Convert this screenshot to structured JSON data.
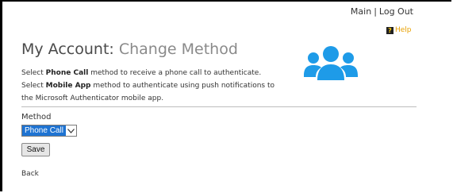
{
  "nav": {
    "main": "Main",
    "separator": "|",
    "logout": "Log Out"
  },
  "help": {
    "icon_glyph": "?",
    "label": "Help",
    "color": "#e8a000"
  },
  "page": {
    "title": "My Account:",
    "subtitle": "Change Method"
  },
  "description": {
    "part1": "Select ",
    "phone_call": "Phone Call",
    "part2": " method to receive a phone call to authenticate. Select ",
    "mobile_app": "Mobile App",
    "part3": " method to authenticate using push notifications to the Microsoft Authenticator mobile app."
  },
  "people_icon": {
    "name": "users-group-icon",
    "color": "#1e9be8"
  },
  "form": {
    "method_label": "Method",
    "method_selected": "Phone Call",
    "save_label": "Save"
  },
  "back_label": "Back",
  "colors": {
    "select_highlight": "#1e73d2",
    "divider": "#bdbdbd"
  }
}
